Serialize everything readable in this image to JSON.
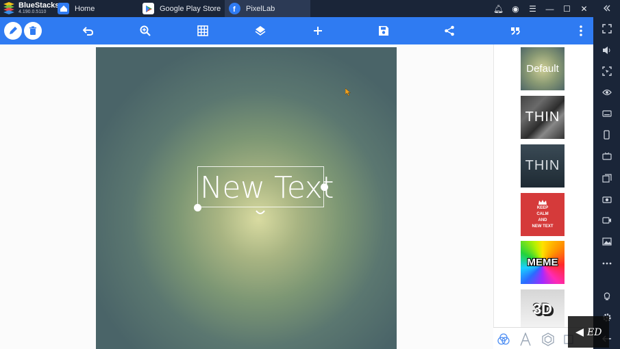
{
  "window": {
    "app_name": "BlueStacks",
    "version": "4.190.0.5110",
    "tabs": [
      {
        "label": "Home",
        "icon": "home-icon"
      },
      {
        "label": "Google Play Store",
        "icon": "play-store-icon"
      },
      {
        "label": "PixelLab",
        "icon": "pixellab-icon",
        "active": true
      }
    ],
    "title_icons": [
      "bell-icon",
      "account-icon",
      "menu-icon",
      "minimize-icon",
      "maximize-icon",
      "close-icon",
      "collapse-sidebar-icon"
    ]
  },
  "toolbar": {
    "icons": [
      "pencil-icon",
      "trash-icon",
      "undo-icon",
      "zoom-icon",
      "grid-icon",
      "layers-icon",
      "add-icon",
      "save-icon",
      "share-icon",
      "quote-icon",
      "more-vert-icon"
    ],
    "accent_color": "#2f7bf2"
  },
  "canvas": {
    "text": "New Text"
  },
  "styles_panel": {
    "presets": [
      {
        "label": "Default"
      },
      {
        "label": "THIN"
      },
      {
        "label": "THIN"
      },
      {
        "label": "KEEP CALM AND NEW TEXT",
        "lines": [
          "KEEP",
          "CALM",
          "AND",
          "NEW TEXT"
        ]
      },
      {
        "label": "MEME"
      },
      {
        "label": "3D"
      }
    ],
    "tabs": [
      "blend-icon",
      "font-icon",
      "shape-icon",
      "layer-square-icon"
    ]
  },
  "bluestacks_sidebar": {
    "icons": [
      "fullscreen-icon",
      "volume-icon",
      "screenshot-select-icon",
      "eye-icon",
      "keyboard-icon",
      "phone-icon",
      "tv-icon",
      "media-import-icon",
      "camera-icon",
      "video-icon",
      "gallery-icon",
      "more-horiz-icon",
      "light-icon",
      "settings-icon",
      "back-icon"
    ]
  },
  "watermark": {
    "text": "ED"
  }
}
